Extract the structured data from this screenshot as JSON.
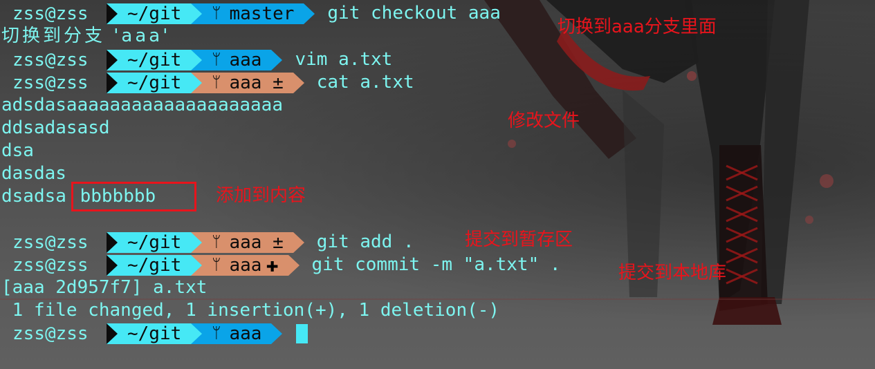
{
  "terminal": {
    "prompt_user": "zss@zss",
    "prompt_dir": "~/git",
    "branch_icon": "git-branch-icon",
    "lines": {
      "l1_branch": "master",
      "l1_cmd": "git checkout aaa",
      "l2_output": "切换到分支 'aaa'",
      "l3_branch": "aaa",
      "l3_cmd": "vim a.txt",
      "l4_branch": "aaa ±",
      "l4_cmd": "cat a.txt",
      "file_line1": "adsdasaaaaaaaaaaaaaaaaaaaa",
      "file_line2": "ddsadasasd",
      "file_line3": "dsa",
      "file_line4": "dasdas",
      "file_line5_a": "dsadsa ",
      "file_line5_b": "bbbbbbb",
      "l10_branch": "aaa ±",
      "l10_cmd": "git add .",
      "l11_branch": "aaa",
      "l11_cmd": "git commit -m \"a.txt\" .",
      "l12_output": "[aaa 2d957f7] a.txt",
      "l13_output": " 1 file changed, 1 insertion(+), 1 deletion(-)",
      "l14_branch": "aaa"
    }
  },
  "annotations": {
    "switch_branch": "切换到aaa分支里面",
    "modify_file": "修改文件",
    "added_content": "添加到内容",
    "commit_staging": "提交到暂存区",
    "commit_local": "提交到本地库"
  },
  "colors": {
    "terminal_text": "#7df5f0",
    "dir_segment": "#46e8f5",
    "branch_clean": "#0aa4e8",
    "branch_dirty": "#d9906c",
    "annotation_red": "#e8141c"
  }
}
